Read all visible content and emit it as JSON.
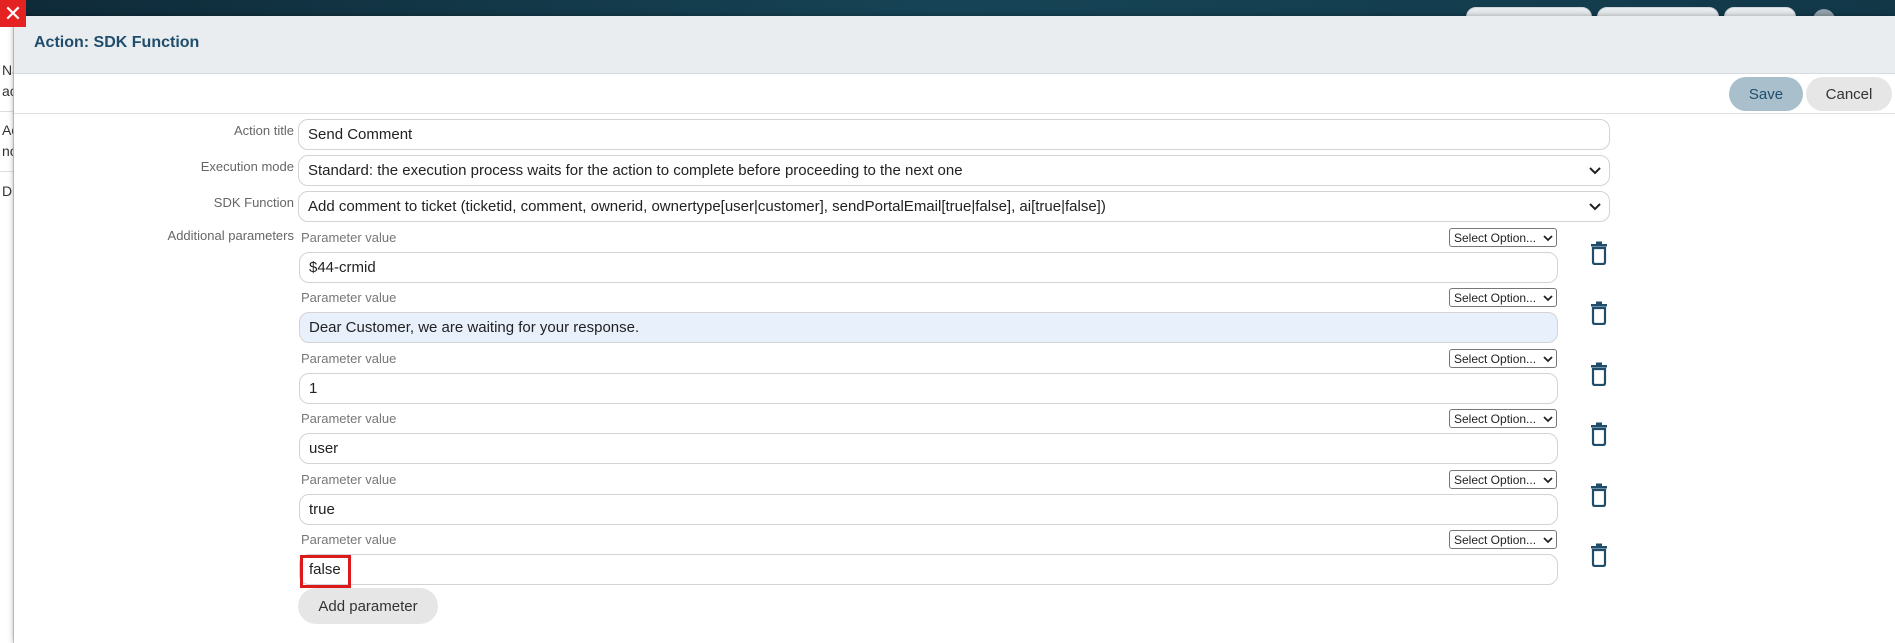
{
  "header": {
    "title": "Action: SDK Function"
  },
  "toolbar": {
    "save_label": "Save",
    "cancel_label": "Cancel"
  },
  "background_fragments": [
    "Na",
    "ac",
    "Ac",
    "nc",
    "D"
  ],
  "form": {
    "action_title": {
      "label": "Action title",
      "value": "Send Comment"
    },
    "execution_mode": {
      "label": "Execution mode",
      "value": "Standard: the execution process waits for the action to complete before proceeding to the next one"
    },
    "sdk_function": {
      "label": "SDK Function",
      "value": "Add comment to ticket (ticketid, comment, ownerid, ownertype[user|customer], sendPortalEmail[true|false], ai[true|false])"
    },
    "additional_label": "Additional parameters",
    "params": [
      {
        "label": "Parameter value",
        "select": "Select Option...",
        "value": "$44-crmid"
      },
      {
        "label": "Parameter value",
        "select": "Select Option...",
        "value": "Dear Customer, we are waiting for your response."
      },
      {
        "label": "Parameter value",
        "select": "Select Option...",
        "value": "1"
      },
      {
        "label": "Parameter value",
        "select": "Select Option...",
        "value": "user"
      },
      {
        "label": "Parameter value",
        "select": "Select Option...",
        "value": "true"
      },
      {
        "label": "Parameter value",
        "select": "Select Option...",
        "value": "false"
      }
    ],
    "add_parameter_label": "Add parameter"
  },
  "icons": {
    "close": "close-icon",
    "delete": "trash-icon",
    "dropdown": "chevron-down-icon"
  },
  "colors": {
    "accent": "#1f4d6b",
    "close": "#e52222",
    "highlight_field": "#e8f0fc",
    "focus_outline": "#dd1a1a"
  }
}
